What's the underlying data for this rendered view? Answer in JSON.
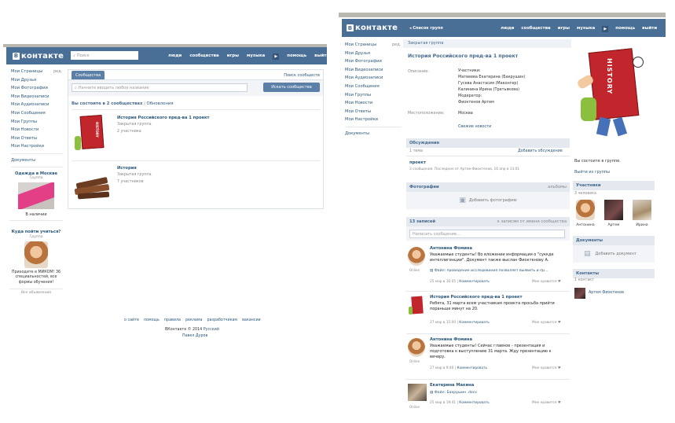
{
  "left": {
    "logo": "контакте",
    "search_placeholder": "Поиск",
    "nav": [
      "люди",
      "сообщества",
      "игры",
      "музыка",
      "помощь",
      "выйти"
    ],
    "sidebar": [
      "Мои Страницы",
      "Мои Друзья",
      "Мои Фотографии",
      "Мои Видеозаписи",
      "Мои Аудиозаписи",
      "Мои Сообщения",
      "Мои Группы",
      "Мои Новости",
      "Мои Ответы",
      "Мои Настройки"
    ],
    "sidebar_edit": "ред.",
    "documents": "Документы",
    "ad1_title": "Одежда в Москве",
    "ad1_sub": "Группа",
    "ad1_badge": "В наличии",
    "ad2_title": "Куда пойти учиться?",
    "ad2_sub": "Группа",
    "ad2_text": "Приходите в МИКОМ! 36 специальностей, все формы обучения!",
    "all_ads": "Все объявления",
    "tab_communities": "Сообщества",
    "search_communities_link": "Поиск сообществ",
    "search_field_placeholder": "Начните вводить любое название",
    "search_btn": "Искать сообщества",
    "count_text": "Вы состоите в 2 сообществах",
    "updates": "Обновления",
    "groups": [
      {
        "name": "История Российского пред-ва 1 проект",
        "type": "Закрытая группа",
        "members": "2 участника"
      },
      {
        "name": "История",
        "type": "Закрытая группа",
        "members": "7 участников"
      }
    ],
    "footer_links": [
      "о сайте",
      "помощь",
      "правила",
      "реклама",
      "разработчикам",
      "вакансии"
    ],
    "footer_copy": "ВКонтакте © 2014",
    "footer_lang": "Русский",
    "footer_author": "Павел Дуров"
  },
  "right": {
    "logo": "контакте",
    "back": "◂ Список групп",
    "nav": [
      "люди",
      "сообщества",
      "игры",
      "музыка",
      "помощь",
      "выйти"
    ],
    "sidebar": [
      "Мои Страницы",
      "Мои Друзья",
      "Мои Фотографии",
      "Мои Видеозаписи",
      "Мои Аудиозаписи",
      "Мои Сообщения",
      "Мои Группы",
      "Мои Новости",
      "Мои Ответы",
      "Мои Настройки"
    ],
    "sidebar_edit": "ред.",
    "documents": "Документы",
    "crumb": "Закрытая группа",
    "title": "История Российского пред-ва 1 проект",
    "desc_label": "Описание:",
    "desc_lines": [
      "Участники:",
      "Матвеева Екатерина (Бакрушин)",
      "Гусева Анастасия (Маконгер)",
      "Калинина Ирина (Третьякова)",
      "Модератор:",
      "Фиоктенов Артем"
    ],
    "place_label": "Местоположение:",
    "place_value": "Москва",
    "news_link": "Свежие новости",
    "discussions": "Обсуждения",
    "topics": "1 тема",
    "add_discussion": "Добавить обсуждение",
    "topic_title": "проект",
    "topic_meta": "3 сообщения. Последнее от Артем Фиоктенов, 16 апр в 13:01",
    "photos": "Фотографии",
    "albums": "альбомы",
    "add_photo": "Добавить фотографию",
    "posts_count": "13 записей",
    "posts_to_group": "к записям от имени сообщества",
    "write_placeholder": "Написать сообщение...",
    "posts": [
      {
        "author": "Антонина Фомина",
        "text": "Уважаемые студенты! Во вложении информация о \"суккде интеллигенции\". Документ также выслан Фиоктенову А.",
        "file": "Файл: проведение исследования позволяет выявить и пр...",
        "meta": "25 мар в 16:05",
        "comment": "Комментировать",
        "like": "Мне нравится"
      },
      {
        "author": "История Российского пред-ва 1 проект",
        "text": "Ребята, 31 марта всем участникам проекта просьба прийти пораньше минут на 20.",
        "meta": "27 мар в 15:00",
        "comment": "Комментировать",
        "like": "Мне нравится"
      },
      {
        "author": "Антонина Фомина",
        "text": "Уважаемые студенты! Сейчас главное - презентация и подготовка к выступлению 31 марта. Жду презентацию к вечеру.",
        "meta": "27 мар в 9:40",
        "comment": "Комментировать",
        "like": "Мне нравится"
      },
      {
        "author": "Екатерина Макина",
        "file": "Файл: Бакрушин .docx",
        "meta": "25 мар в 19:41",
        "comment": "Комментировать",
        "like": "Мне нравится"
      }
    ],
    "online": "Online",
    "member_status": "Вы состоите в группе.",
    "leave": "Выйти из группы",
    "members_title": "Участники",
    "members_count": "3 человека",
    "members": [
      "Антонина",
      "Артем",
      "Ирина"
    ],
    "docs_title": "Документы",
    "add_doc": "Добавить документ",
    "contacts_title": "Контакты",
    "contacts_count": "1 контакт",
    "contact_name": "Артем Фиоктенов",
    "book_title": "HISTORY"
  }
}
